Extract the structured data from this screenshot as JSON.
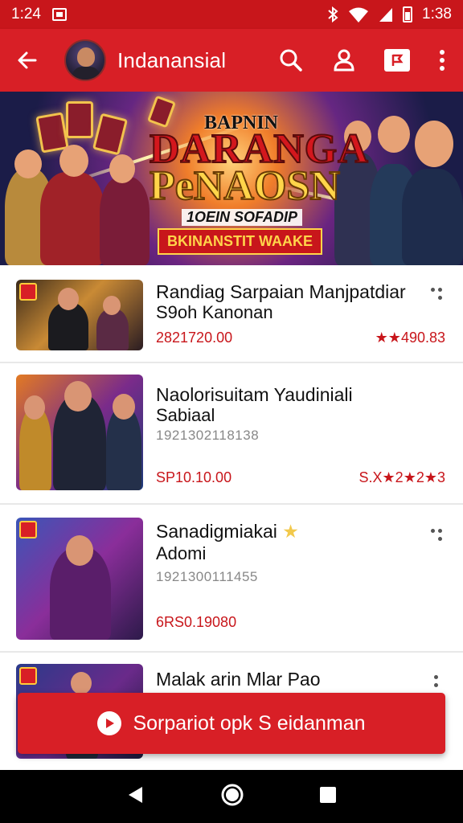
{
  "status_bar": {
    "time": "1:24",
    "right_time": "1:38"
  },
  "app_bar": {
    "title": "Indanansial"
  },
  "banner": {
    "line1": "BAPNIN",
    "line2": "DARANGA",
    "line3": "PeNAOSN",
    "line4": "1OEIN SOFADIP",
    "line5": "BKINANSTIT WAAKE"
  },
  "items": [
    {
      "title": "Randiag Sarpaian Manjpatdiar",
      "subtitle": "S9oh Kanonan",
      "meta": "",
      "price": "2821720.00",
      "rating": "★★490.83"
    },
    {
      "title": "Naolorisuitam Yaudiniali",
      "subtitle": "Sabiaal",
      "meta": "1921302118138",
      "price": "SP10.10.00",
      "rating": "S.X★2★2★3"
    },
    {
      "title": "Sanadigmiakai",
      "subtitle": "Adomi",
      "meta": "1921300111455",
      "price": "6RS0.19080",
      "rating": ""
    },
    {
      "title": "Malak arin Mlar Pao",
      "subtitle": "",
      "meta": "",
      "price": "",
      "rating": ""
    }
  ],
  "cta": {
    "label": "Sorpariot opk S eidanman"
  },
  "colors": {
    "brand_red": "#d81f26",
    "status_red": "#c8161b",
    "price_red": "#c8161b",
    "star_yellow": "#f2c94c"
  },
  "icons": [
    "back-arrow-icon",
    "search-icon",
    "profile-icon",
    "flag-icon",
    "more-vert-icon",
    "kebab-icon",
    "play-icon",
    "nav-back-icon",
    "nav-home-icon",
    "nav-recents-icon"
  ]
}
